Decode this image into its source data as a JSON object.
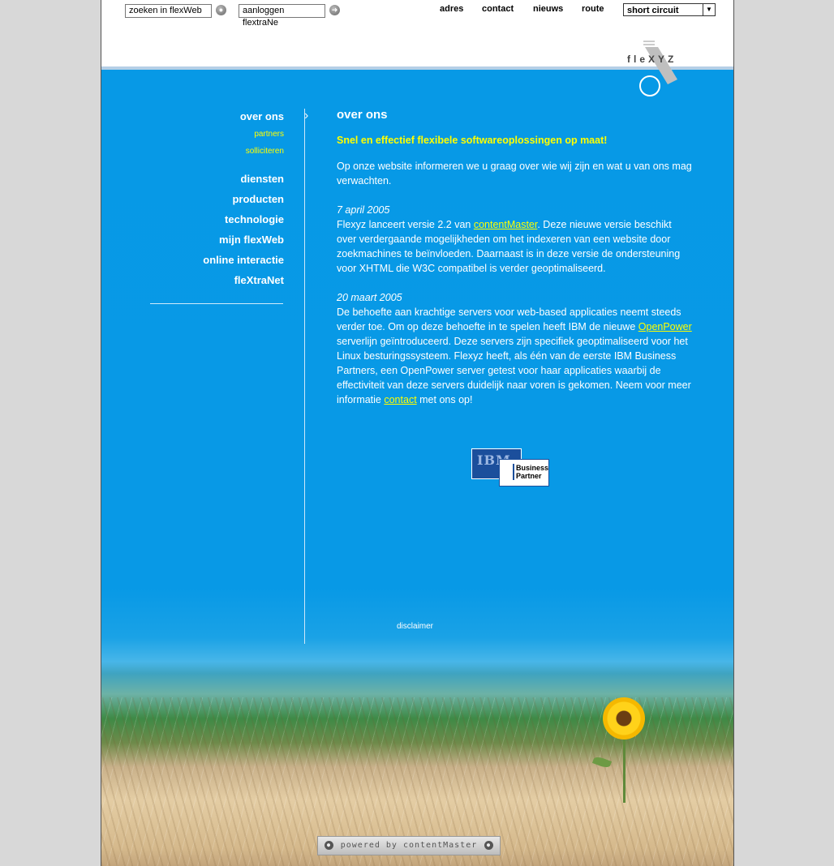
{
  "header": {
    "search_value": "zoeken in flexWeb",
    "login_value": "aanloggen flextraNe",
    "links": [
      "adres",
      "contact",
      "nieuws",
      "route"
    ],
    "select_value": "short circuit",
    "logo_text": "fleXYZ"
  },
  "nav": {
    "items": [
      {
        "label": "over ons"
      },
      {
        "label": "partners"
      },
      {
        "label": "solliciteren"
      },
      {
        "label": "diensten"
      },
      {
        "label": "producten"
      },
      {
        "label": "technologie"
      },
      {
        "label": "mijn flexWeb"
      },
      {
        "label": "online interactie"
      },
      {
        "label": "fleXtraNet"
      }
    ]
  },
  "content": {
    "title": "over ons",
    "subtitle": "Snel en effectief flexibele softwareoplossingen op maat!",
    "intro": "Op onze website informeren we u graag over wie wij zijn en wat u van ons mag verwachten.",
    "news1_date": "7 april 2005",
    "news1_pre": "Flexyz lanceert versie 2.2 van ",
    "news1_link": "contentMaster",
    "news1_post": ". Deze nieuwe versie beschikt over verdergaande mogelijkheden om het indexeren van een website door zoekmachines te beïnvloeden. Daarnaast is in deze versie de ondersteuning voor XHTML die W3C compatibel is verder geoptimaliseerd.",
    "news2_date": "20 maart 2005",
    "news2_pre": "De behoefte aan krachtige servers voor web-based applicaties neemt steeds verder toe. Om op deze behoefte in te spelen heeft IBM de nieuwe ",
    "news2_link": "OpenPower",
    "news2_mid": " serverlijn geïntroduceerd. Deze servers zijn specifiek geoptimaliseerd voor het Linux besturingssysteem. Flexyz heeft, als één van de eerste IBM Business Partners, een OpenPower server getest voor haar applicaties waarbij de effectiviteit van deze servers duidelijk naar voren is gekomen. Neem voor meer informatie ",
    "news2_link2": "contact",
    "news2_post": " met ons op!",
    "ibm_text": "IBM",
    "bp_line1": "Business",
    "bp_line2": "Partner"
  },
  "footer": {
    "disclaimer": "disclaimer",
    "powered": "powered by contentMaster"
  },
  "colors": {
    "main_blue": "#0799e6",
    "accent_yellow": "#ffff00"
  }
}
